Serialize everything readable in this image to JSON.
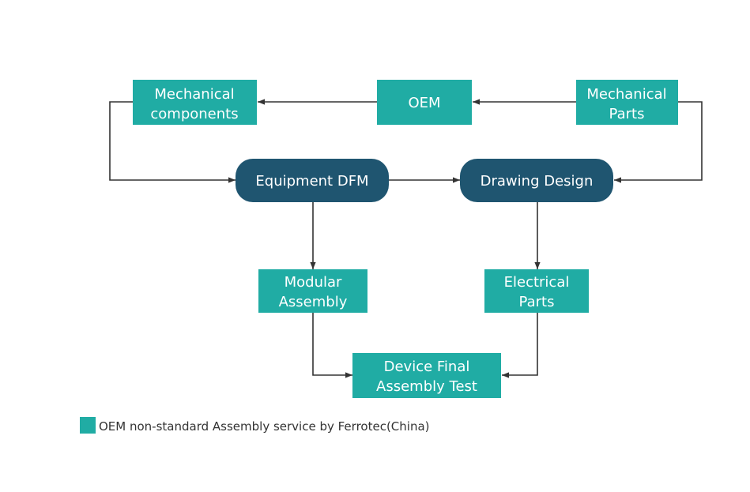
{
  "colors": {
    "service_box": "#20ACA4",
    "process_box": "#1F5570",
    "connector": "#333333"
  },
  "nodes": {
    "mechanical_components": [
      "Mechanical",
      "components"
    ],
    "oem": [
      "OEM"
    ],
    "mechanical_parts": [
      "Mechanical",
      "Parts"
    ],
    "equipment_dfm": [
      "Equipment DFM"
    ],
    "drawing_design": [
      "Drawing Design"
    ],
    "modular_assembly": [
      "Modular",
      "Assembly"
    ],
    "electrical_parts": [
      "Electrical",
      "Parts"
    ],
    "device_final_assembly_test": [
      "Device Final",
      "Assembly Test"
    ]
  },
  "legend": {
    "label": "OEM non-standard Assembly service by Ferrotec(China)"
  }
}
